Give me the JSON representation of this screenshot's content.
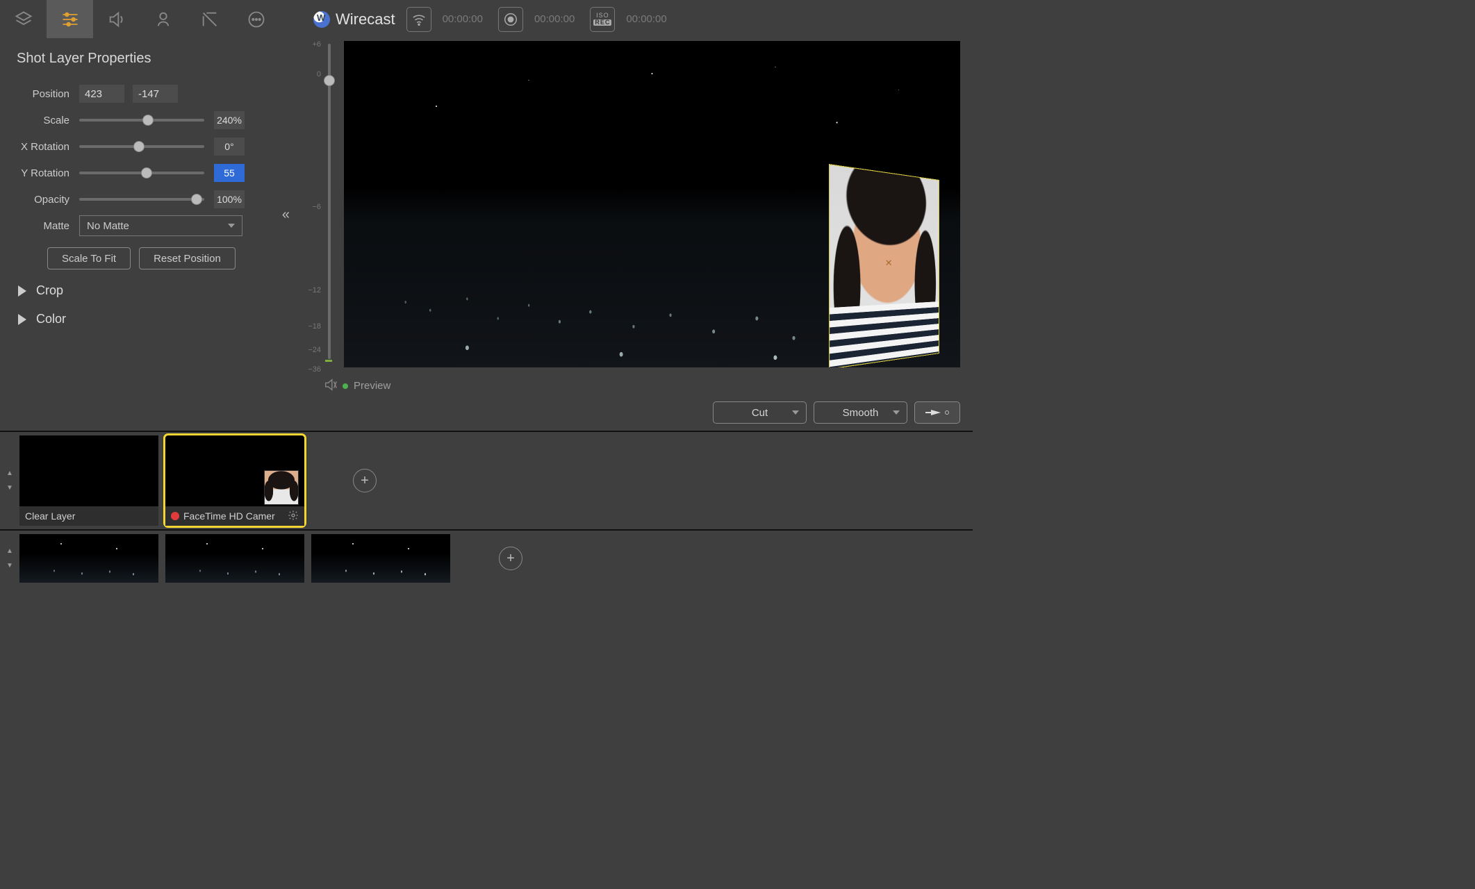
{
  "panel_title": "Shot Layer Properties",
  "fields": {
    "position_label": "Position",
    "position_x": "423",
    "position_y": "-147",
    "scale_label": "Scale",
    "scale_val": "240%",
    "scale_pct": 55,
    "xrot_label": "X Rotation",
    "xrot_val": "0°",
    "xrot_pct": 48,
    "yrot_label": "Y Rotation",
    "yrot_val": "55",
    "yrot_pct": 54,
    "opacity_label": "Opacity",
    "opacity_val": "100%",
    "opacity_pct": 94,
    "matte_label": "Matte",
    "matte_value": "No Matte",
    "fit_btn": "Scale To Fit",
    "reset_btn": "Reset Position"
  },
  "disclosures": {
    "crop": "Crop",
    "color": "Color"
  },
  "brand": "Wirecast",
  "timers": {
    "stream": "00:00:00",
    "record": "00:00:00",
    "iso": "00:00:00"
  },
  "iso_label_top": "ISO",
  "iso_label_bot": "REC",
  "audio_ticks": [
    "+6",
    "",
    "0",
    "",
    "",
    "",
    "−6",
    "",
    "",
    "−12",
    "",
    "−18",
    "−24",
    "−36"
  ],
  "vslider_pct": 10,
  "preview_label": "Preview",
  "transition": {
    "cut": "Cut",
    "smooth": "Smooth"
  },
  "shots_row1": {
    "clear": "Clear Layer",
    "selected": "FaceTime HD Camer"
  }
}
